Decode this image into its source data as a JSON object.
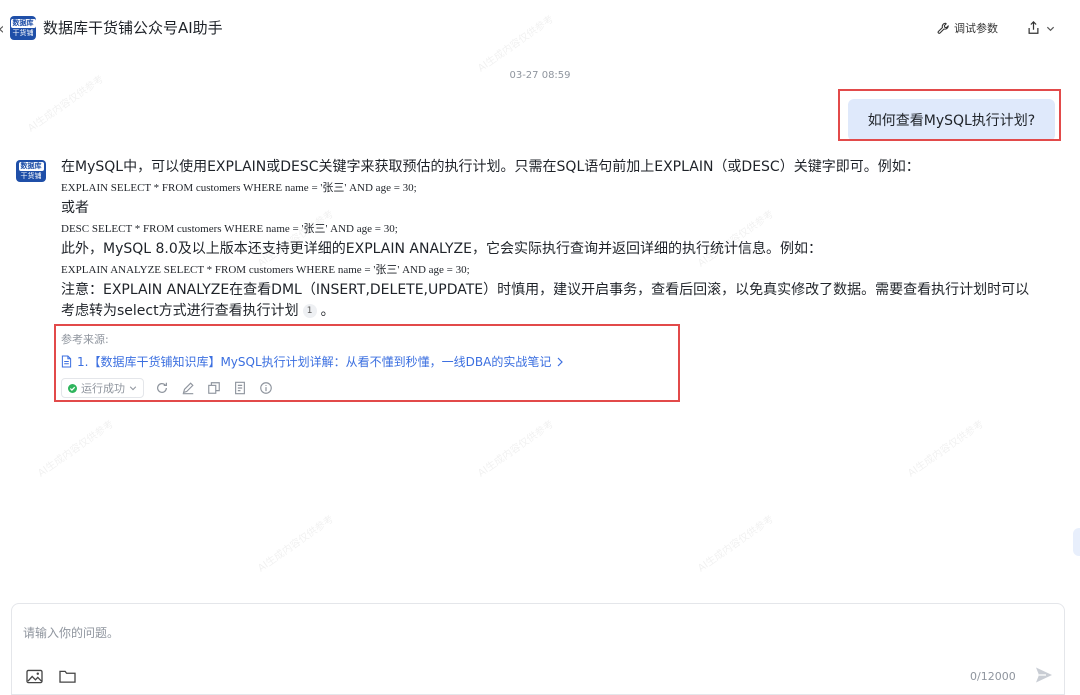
{
  "header": {
    "logo_top": "数据库",
    "logo_bottom": "干货铺",
    "title": "数据库干货铺公众号AI助手",
    "debug_label": "调试参数",
    "back_icon": "chevron-left-icon",
    "debug_icon": "wrench-icon",
    "share_icon": "share-icon"
  },
  "chat": {
    "timestamp": "03-27 08:59",
    "user_message": "如何查看MySQL执行计划?",
    "answer": {
      "line1": "在MySQL中，可以使用EXPLAIN或DESC关键字来获取预估的执行计划。只需在SQL语句前加上EXPLAIN（或DESC）关键字即可。例如：",
      "code1": "EXPLAIN SELECT * FROM customers WHERE name = '张三' AND age = 30;",
      "line2": "或者",
      "code2": "DESC SELECT * FROM customers WHERE name = '张三' AND age = 30;",
      "line3": "此外，MySQL 8.0及以上版本还支持更详细的EXPLAIN ANALYZE，它会实际执行查询并返回详细的执行统计信息。例如：",
      "code3": "EXPLAIN ANALYZE SELECT * FROM customers WHERE name = '张三' AND age = 30;",
      "line4a": "注意：EXPLAIN ANALYZE在查看DML（INSERT,DELETE,UPDATE）时慎用，建议开启事务，查看后回滚，以免真实修改了数据。需要查看执行计划时可以",
      "line4b": "考虑转为select方式进行查看执行计划",
      "citation": "1",
      "line4_end": "。"
    },
    "references": {
      "title": "参考来源:",
      "items": [
        {
          "label": "1.【数据库干货铺知识库】MySQL执行计划详解：从看不懂到秒懂，一线DBA的实战笔记"
        }
      ]
    },
    "toolbar": {
      "status": "运行成功",
      "icons": [
        "refresh-icon",
        "edit-icon",
        "copy-icon",
        "note-icon",
        "info-icon"
      ]
    }
  },
  "watermark": "AI生成内容仅供参考",
  "input": {
    "placeholder": "请输入你的问题。",
    "counter": "0/12000",
    "icons": [
      "image-icon",
      "folder-icon",
      "send-icon"
    ]
  },
  "colors": {
    "accent": "#3b6fe0",
    "user_bubble": "#dfe9fb",
    "highlight": "#e24a4a",
    "success": "#2fb55d"
  }
}
